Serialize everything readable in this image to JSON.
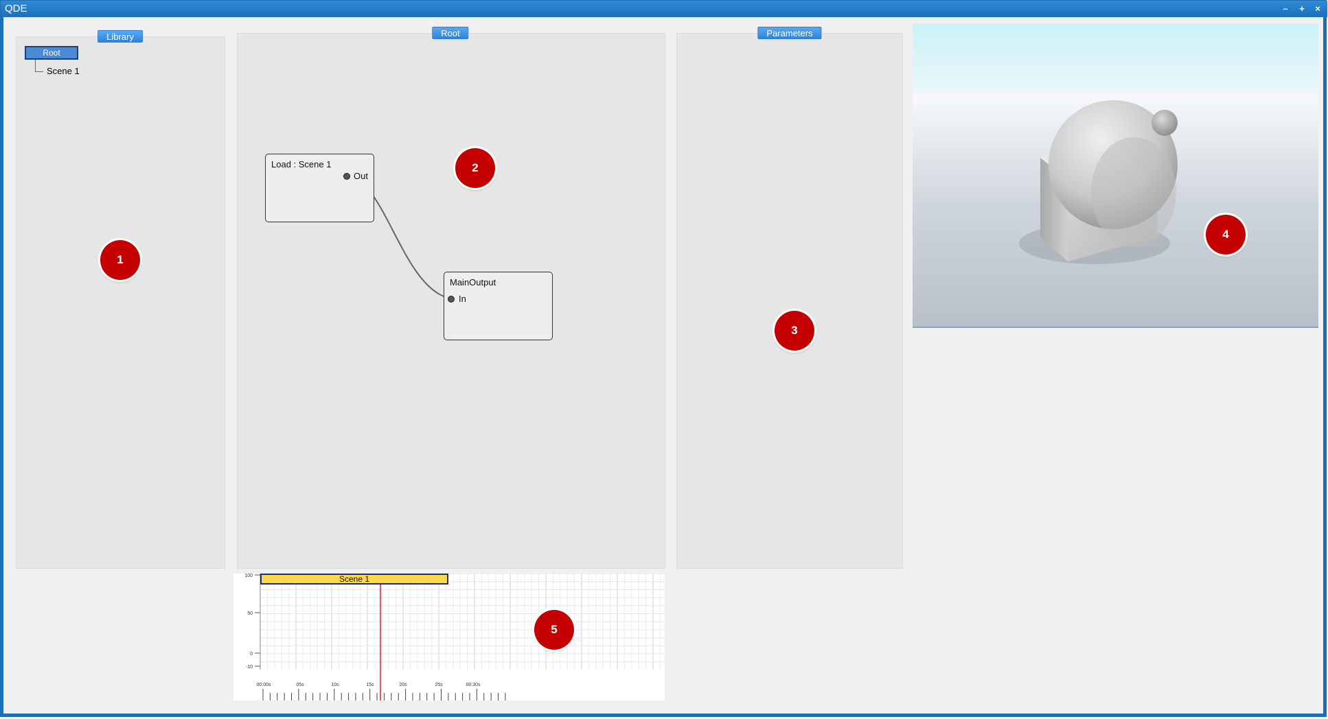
{
  "app": {
    "title": "QDE"
  },
  "window_controls": {
    "minimize": "–",
    "maximize": "+",
    "close": "×"
  },
  "library": {
    "title": "Library",
    "root_label": "Root",
    "children": [
      "Scene 1"
    ]
  },
  "graph": {
    "title": "Root",
    "nodes": [
      {
        "title": "Load : Scene 1",
        "port": "Out"
      },
      {
        "title": "MainOutput",
        "port": "In"
      }
    ]
  },
  "parameters": {
    "title": "Parameters"
  },
  "markers": [
    "1",
    "2",
    "3",
    "4",
    "5"
  ],
  "timeline": {
    "clip_label": "Scene 1",
    "y_ticks": [
      "100",
      "50",
      "0",
      "-10"
    ],
    "time_labels": [
      "00:00s",
      "05s",
      "10s",
      "15s",
      "20s",
      "25s",
      "00:30s"
    ]
  },
  "colors": {
    "accent": "#2c85dc",
    "marker": "#c40000",
    "clip": "#ffd84a",
    "playhead": "#e02020"
  }
}
